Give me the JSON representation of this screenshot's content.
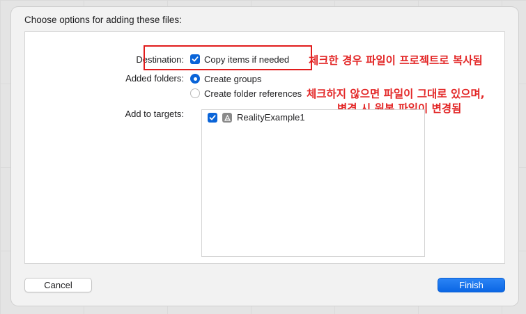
{
  "dialog": {
    "title": "Choose options for adding these files:"
  },
  "destination": {
    "label": "Destination:",
    "option_label": "Copy items if needed",
    "checked": true
  },
  "added_folders": {
    "label": "Added folders:",
    "options": [
      {
        "label": "Create groups",
        "selected": true
      },
      {
        "label": "Create folder references",
        "selected": false
      }
    ]
  },
  "targets": {
    "label": "Add to targets:",
    "items": [
      {
        "label": "RealityExample1",
        "checked": true,
        "icon": "app-target-icon"
      }
    ]
  },
  "annotations": {
    "note1": "체크한 경우 파일이 프로젝트로 복사됨",
    "note2_line1": "체크하지 않으면 파일이 그대로 있으며,",
    "note2_line2": "변경 시 원본 파일이 변경됨",
    "color": "#e32727"
  },
  "buttons": {
    "cancel_label": "Cancel",
    "finish_label": "Finish"
  },
  "colors": {
    "accent": "#0a64d8",
    "highlight_border": "#e11c1c"
  }
}
